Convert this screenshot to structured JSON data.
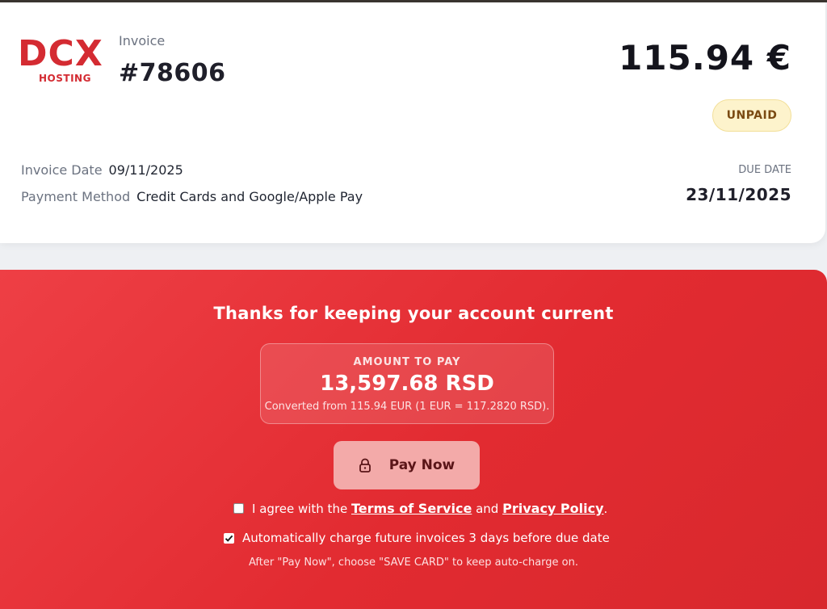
{
  "brand": {
    "logo_main": "DCX",
    "logo_sub": "HOSTING",
    "accent": "#d42b32"
  },
  "invoice": {
    "label": "Invoice",
    "number": "#78606",
    "total": "115.94 €",
    "status": "UNPAID",
    "invoice_date_label": "Invoice Date",
    "invoice_date": "09/11/2025",
    "payment_method_label": "Payment Method",
    "payment_method": "Credit Cards and Google/Apple Pay",
    "due_date_label": "DUE DATE",
    "due_date": "23/11/2025"
  },
  "payment": {
    "thanks": "Thanks for keeping your account current",
    "amount_label": "AMOUNT TO PAY",
    "amount_value": "13,597.68 RSD",
    "amount_note": "Converted from 115.94 EUR (1 EUR = 117.2820 RSD).",
    "pay_button": "Pay Now",
    "agree_prefix": "I agree with the",
    "terms_link": "Terms of Service",
    "agree_and": "and",
    "privacy_link": "Privacy Policy",
    "agree_suffix": ".",
    "agree_checked": false,
    "auto_charge_label": "Automatically charge future invoices 3 days before due date",
    "auto_charge_checked": true,
    "hint": "After \"Pay Now\", choose \"SAVE CARD\" to keep auto-charge on.",
    "panel_color": "#e22b31",
    "button_color": "#f3aaa9"
  },
  "icons": {
    "pay_button_icon": "lock-icon",
    "checkmark": "check-icon"
  }
}
